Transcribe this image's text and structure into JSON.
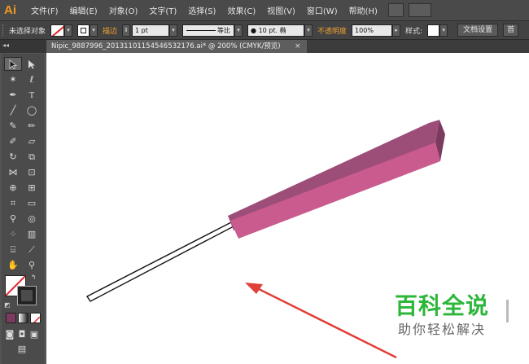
{
  "app": {
    "logo": "Ai",
    "logo_color": "#f29b1d"
  },
  "menu": {
    "items": [
      "文件(F)",
      "编辑(E)",
      "对象(O)",
      "文字(T)",
      "选择(S)",
      "效果(C)",
      "视图(V)",
      "窗口(W)",
      "帮助(H)"
    ]
  },
  "control": {
    "selection_label": "未选择对象",
    "stroke_label": "描边",
    "stroke_weight": "1 pt",
    "profile_label": "等比",
    "brush_label": "10 pt. 椭",
    "opacity_label": "不透明度",
    "opacity_value": "100%",
    "style_label": "样式:",
    "doc_setup_button": "文档设置",
    "extra_button": "首"
  },
  "document": {
    "tab_title": "Nipic_9887996_20131101154546532176.ai* @ 200% (CMYK/预览)",
    "tab_close": "×"
  },
  "watermark": {
    "title": "百科全说",
    "subtitle": "助你轻松解决"
  },
  "colors": {
    "umbrella_top": "#9c4d78",
    "umbrella_front": "#c95b8e",
    "umbrella_side": "#7b3a5f",
    "arrow": "#e0403a",
    "fill_none": "#ffffff"
  }
}
